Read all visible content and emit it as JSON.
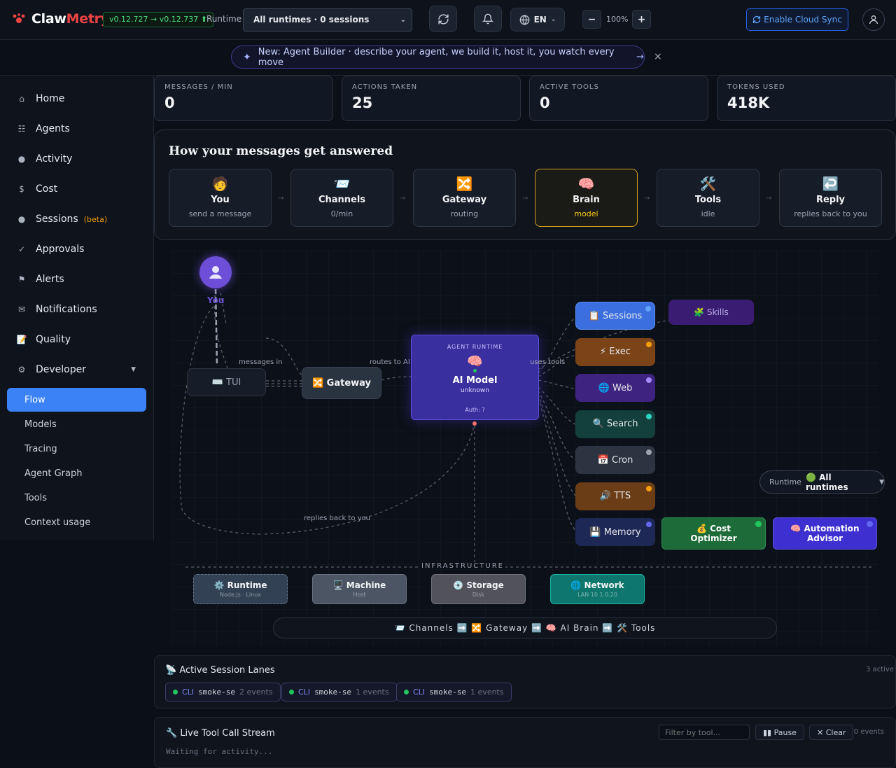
{
  "header": {
    "logo_claw": "Claw",
    "logo_metry": "Metry",
    "version": "v0.12.727 → v0.12.737 ⬆",
    "runtime_label": "Runtime",
    "runtime_select": "All runtimes · 0 sessions",
    "lang": "EN",
    "zoom": "100%",
    "cloud_sync": "Enable Cloud Sync",
    "icons": [
      "refresh-icon",
      "bell-icon",
      "globe-icon",
      "user-icon"
    ]
  },
  "announcement": {
    "text": "New: Agent Builder · describe your agent, we build it, host it, you watch every move",
    "arrow": "→",
    "close": "×"
  },
  "sidebar": {
    "items": [
      {
        "icon": "⌂",
        "label": "Home"
      },
      {
        "icon": "☷",
        "label": "Agents"
      },
      {
        "icon": "●",
        "label": "Activity"
      },
      {
        "icon": "$",
        "label": "Cost"
      },
      {
        "icon": "●",
        "label": "Sessions",
        "badge": "(beta)"
      },
      {
        "icon": "✓",
        "label": "Approvals"
      },
      {
        "icon": "⚑",
        "label": "Alerts"
      },
      {
        "icon": "✉",
        "label": "Notifications"
      },
      {
        "icon": "📝",
        "label": "Quality"
      },
      {
        "icon": "⚙",
        "label": "Developer",
        "caret": "▼"
      }
    ],
    "sub_items": [
      "Flow",
      "Models",
      "Tracing",
      "Agent Graph",
      "Tools",
      "Context usage"
    ],
    "active_sub": "Flow"
  },
  "stats": [
    {
      "label": "MESSAGES / MIN",
      "value": "0"
    },
    {
      "label": "ACTIONS TAKEN",
      "value": "25"
    },
    {
      "label": "ACTIVE TOOLS",
      "value": "0"
    },
    {
      "label": "TOKENS USED",
      "value": "418K"
    }
  ],
  "pipeline": {
    "title": "How your messages get answered",
    "steps": [
      {
        "emoji": "🧑",
        "name": "You",
        "sub": "send a message"
      },
      {
        "emoji": "📨",
        "name": "Channels",
        "sub": "0/min"
      },
      {
        "emoji": "🔀",
        "name": "Gateway",
        "sub": "routing"
      },
      {
        "emoji": "🧠",
        "name": "Brain",
        "sub": "model"
      },
      {
        "emoji": "🛠️",
        "name": "Tools",
        "sub": "idle"
      },
      {
        "emoji": "↩️",
        "name": "Reply",
        "sub": "replies back to you"
      }
    ],
    "arrow": "→"
  },
  "flow": {
    "you_label": "You",
    "tui": "⌨️ TUI",
    "gateway": "🔀 Gateway",
    "model_kicker": "AGENT RUNTIME",
    "model_emoji": "🧠",
    "model_title": "AI Model",
    "model_sub": "unknown",
    "model_auth": "Auth: ?",
    "edge_messages_in": "messages in",
    "edge_routes_to_ai": "routes to AI",
    "edge_uses_tools": "uses tools",
    "edge_replies": "replies back to you",
    "tools": [
      {
        "label": "📋 Sessions",
        "color": "#3b6fe0",
        "dot": "#60a5fa"
      },
      {
        "label": "⚡ Exec",
        "color": "#7a4418",
        "dot": "#f59e0b"
      },
      {
        "label": "🌐 Web",
        "color": "#3f2380",
        "dot": "#a78bfa"
      },
      {
        "label": "🔍 Search",
        "color": "#13403c",
        "dot": "#2dd4bf"
      },
      {
        "label": "📅 Cron",
        "color": "#2c3442",
        "dot": "#9ca3af"
      },
      {
        "label": "🔊 TTS",
        "color": "#6b3d16",
        "dot": "#f59e0b"
      },
      {
        "label": "💾 Memory",
        "color": "#1e2856",
        "dot": "#6366f1"
      }
    ],
    "skills": "🧩 Skills",
    "cost_optimizer": "💰 Cost Optimizer",
    "automation_advisor": "🧠 Automation Advisor",
    "infra_title": "INFRASTRUCTURE",
    "infra": [
      {
        "label": "⚙️ Runtime",
        "sub": "Node.js · Linux"
      },
      {
        "label": "🖥️ Machine",
        "sub": "Host"
      },
      {
        "label": "💿 Storage",
        "sub": "Disk"
      },
      {
        "label": "🌐 Network",
        "sub": "LAN 10.1.0.20"
      }
    ],
    "legend": "📨 Channels ➡️ 🔀 Gateway ➡️ 🧠 AI Brain ➡️ 🛠️ Tools",
    "runtime_float_label": "Runtime",
    "runtime_float_value": "🟢 All runtimes",
    "runtime_float_caret": "▼"
  },
  "lanes": {
    "title": "📡 Active Session Lanes",
    "count": "3 active",
    "chips": [
      {
        "cli": "CLI",
        "name": "smoke-se",
        "events": "2 events"
      },
      {
        "cli": "CLI",
        "name": "smoke-se",
        "events": "1 events"
      },
      {
        "cli": "CLI",
        "name": "smoke-se",
        "events": "1 events"
      }
    ]
  },
  "stream": {
    "title": "🔧 Live Tool Call Stream",
    "filter_placeholder": "Filter by tool...",
    "pause": "▮▮ Pause",
    "clear": "✕ Clear",
    "events": "0 events",
    "waiting": "Waiting for activity..."
  }
}
